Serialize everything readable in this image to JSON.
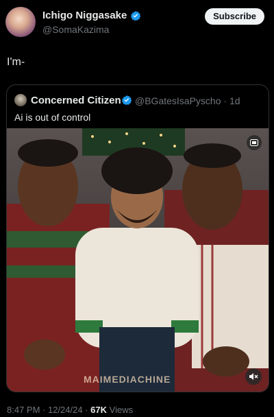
{
  "post": {
    "author_name": "Ichigo Niggasake",
    "author_handle": "@SomaKazima",
    "subscribe_label": "Subscribe",
    "text": "I'm-"
  },
  "quote": {
    "author_name": "Concerned Citizen",
    "author_handle": "@BGatesIsaPyscho",
    "age": "1d",
    "text": "Ai is out of control",
    "media": {
      "watermark": "MAIMEDIACHINE"
    }
  },
  "footer": {
    "time": "8:47 PM",
    "date": "12/24/24",
    "views_count": "67K",
    "views_label": "Views"
  },
  "icons": [
    "verified-badge-icon",
    "gif-icon",
    "mute-icon"
  ],
  "colors": {
    "verified": "#1d9bf0",
    "background": "#000000",
    "muted_text": "#71767b"
  }
}
